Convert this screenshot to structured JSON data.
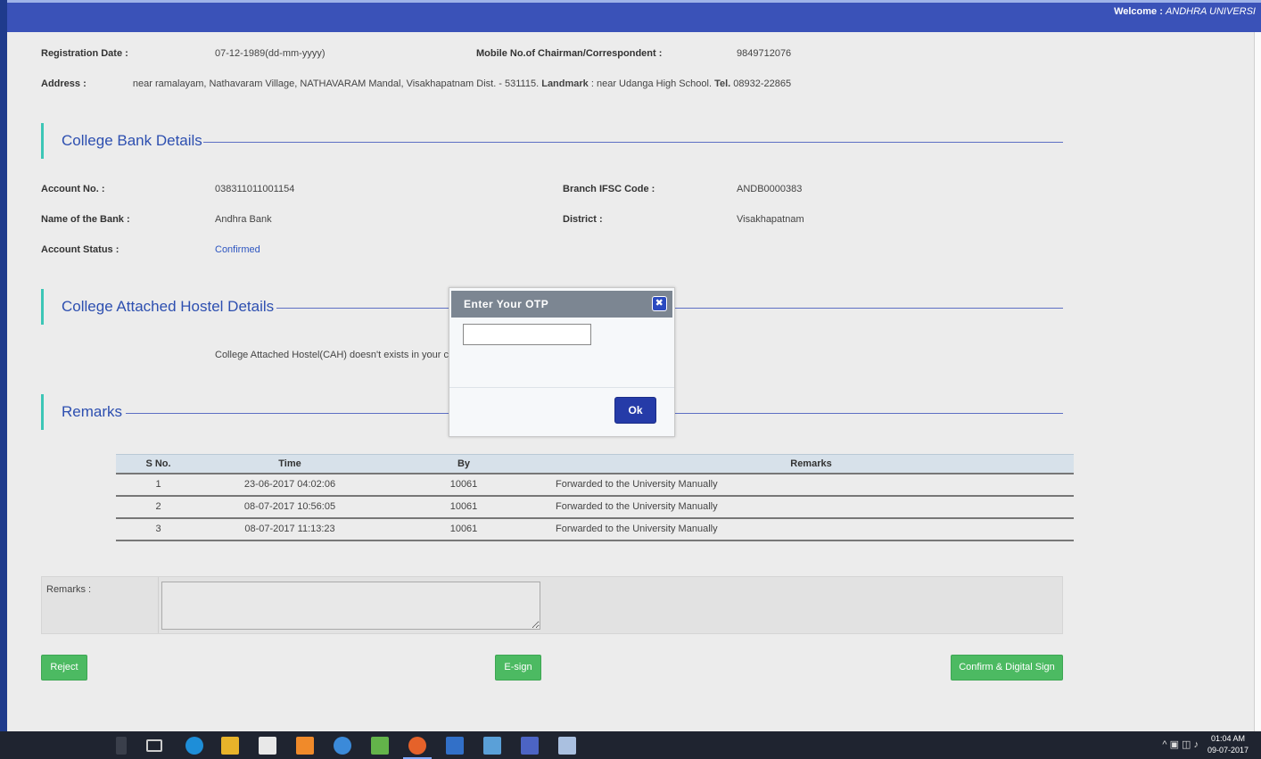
{
  "header": {
    "welcome_label": "Welcome :",
    "welcome_name": "ANDHRA UNIVERSI"
  },
  "college": {
    "registration_date_label": "Registration Date :",
    "registration_date": "07-12-1989(dd-mm-yyyy)",
    "mobile_label": "Mobile No.of Chairman/Correspondent :",
    "mobile": "9849712076",
    "address_label": "Address :",
    "address": "near ramalayam, Nathavaram Village, NATHAVARAM Mandal, Visakhapatnam Dist. - 531115.",
    "landmark_label": "Landmark",
    "landmark": ": near Udanga High School.",
    "tel_label": "Tel.",
    "tel": "08932-22865"
  },
  "bank": {
    "title": "College Bank Details",
    "account_no_label": "Account No. :",
    "account_no": "038311011001154",
    "ifsc_label": "Branch IFSC Code :",
    "ifsc": "ANDB0000383",
    "bank_name_label": "Name of the Bank :",
    "bank_name": "Andhra Bank",
    "district_label": "District :",
    "district": "Visakhapatnam",
    "status_label": "Account Status :",
    "status": "Confirmed"
  },
  "hostel": {
    "title": "College Attached Hostel Details",
    "message": "College Attached Hostel(CAH) doesn't exists in your col"
  },
  "remarks_section": {
    "title": "Remarks",
    "columns": [
      "S No.",
      "Time",
      "By",
      "Remarks"
    ],
    "rows": [
      {
        "sno": "1",
        "time": "23-06-2017 04:02:06",
        "by": "10061",
        "remarks": "Forwarded to the University Manually"
      },
      {
        "sno": "2",
        "time": "08-07-2017 10:56:05",
        "by": "10061",
        "remarks": "Forwarded to the University Manually"
      },
      {
        "sno": "3",
        "time": "08-07-2017 11:13:23",
        "by": "10061",
        "remarks": "Forwarded to the University Manually"
      }
    ]
  },
  "remarks_form": {
    "label": "Remarks :",
    "value": ""
  },
  "actions": {
    "reject": "Reject",
    "esign": "E-sign",
    "confirm": "Confirm & Digital Sign"
  },
  "otp_dialog": {
    "title": "Enter Your OTP",
    "close_glyph": "✖",
    "input_value": "",
    "ok": "Ok"
  },
  "taskbar": {
    "time": "01:04 AM",
    "date": "09-07-2017"
  },
  "colors": {
    "header_blue": "#3a52b8",
    "section_title": "#2d4fb0",
    "accent_teal": "#3cc6b6",
    "button_green": "#4cba62",
    "ok_blue": "#253ba8"
  }
}
